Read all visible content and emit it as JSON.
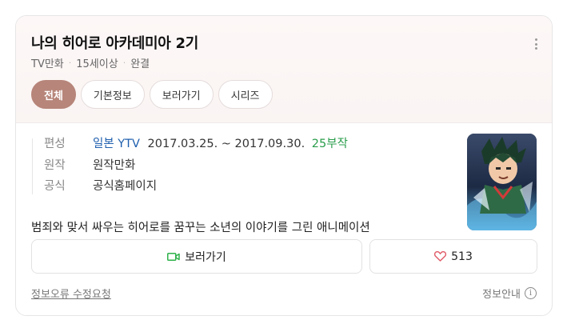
{
  "title": "나의 히어로 아카데미아 2기",
  "meta": [
    "TV만화",
    "15세이상",
    "완결"
  ],
  "tabs": [
    {
      "label": "전체"
    },
    {
      "label": "기본정보"
    },
    {
      "label": "보러가기"
    },
    {
      "label": "시리즈"
    }
  ],
  "info": {
    "broadcast_key": "편성",
    "broadcast_network": "일본 YTV",
    "broadcast_period": "2017.03.25. ~ 2017.09.30.",
    "broadcast_episodes": "25부작",
    "original_key": "원작",
    "original_value": "원작만화",
    "official_key": "공식",
    "official_value": "공식홈페이지"
  },
  "description": "범죄와 맞서 싸우는 히어로를 꿈꾸는 소년의 이야기를 그린 애니메이션",
  "actions": {
    "watch_label": "보러가기",
    "like_count": "513"
  },
  "footer": {
    "report_label": "정보오류 수정요청",
    "info_label": "정보안내",
    "info_icon": "i"
  },
  "colors": {
    "accent": "#b7857a",
    "link": "#1f5fae",
    "episodes": "#2a9d4b",
    "heart": "#e05a67",
    "watch_icon": "#2eb24a"
  }
}
